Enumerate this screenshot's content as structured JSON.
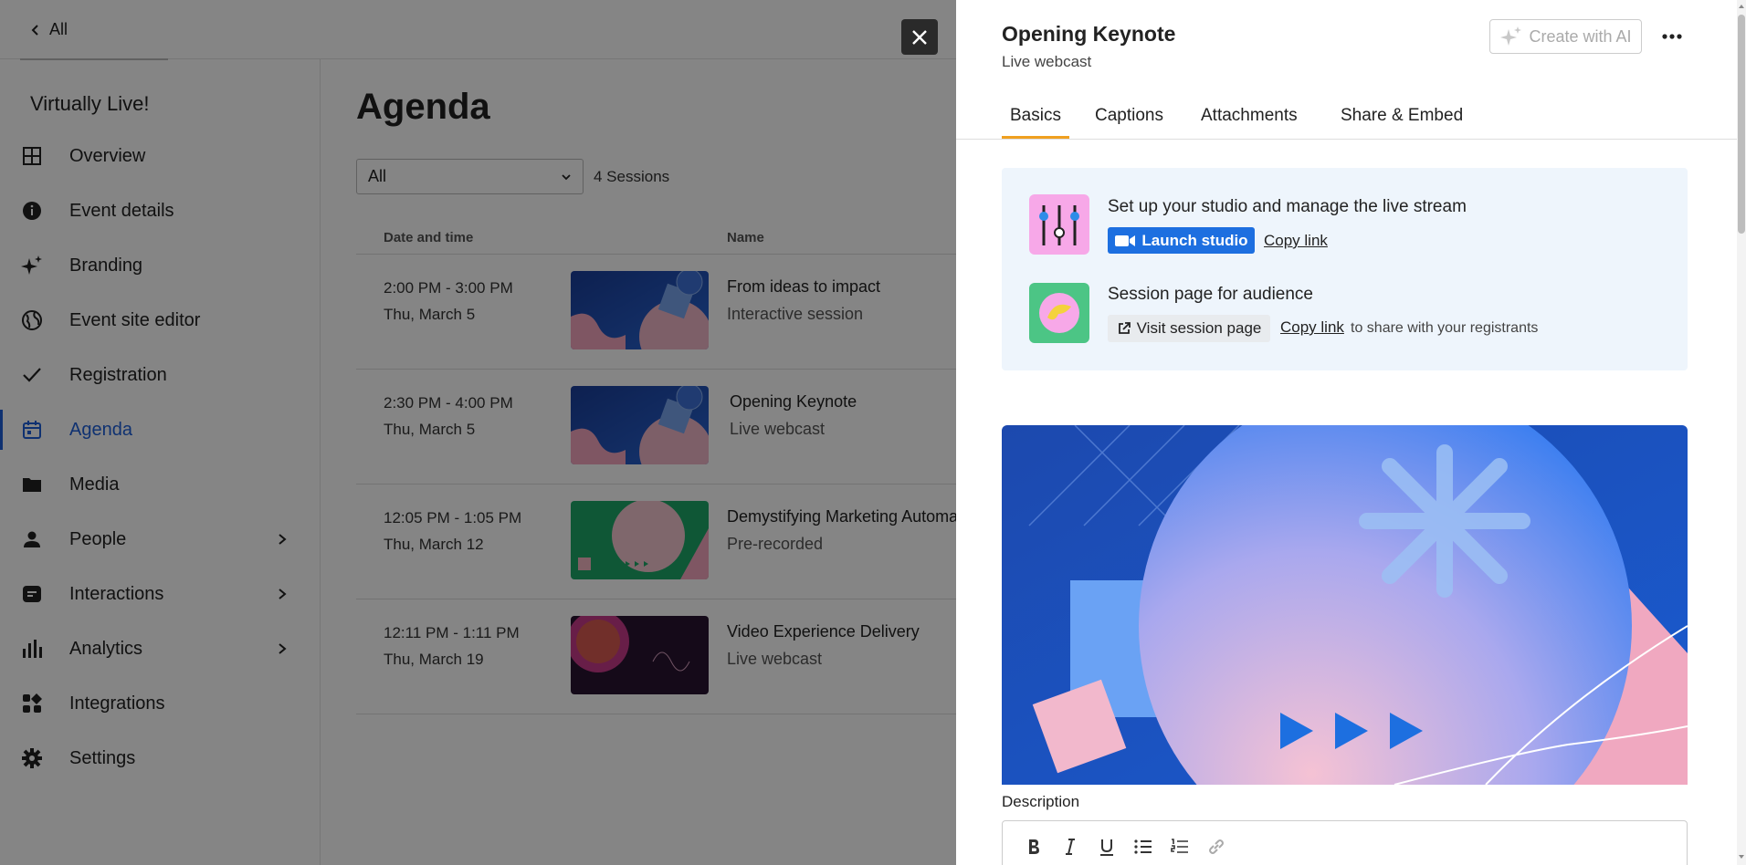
{
  "topbar": {
    "back_label": "All"
  },
  "sidebar": {
    "event_title": "Virtually Live!",
    "items": [
      {
        "label": "Overview",
        "icon": "grid-icon"
      },
      {
        "label": "Event details",
        "icon": "info-icon"
      },
      {
        "label": "Branding",
        "icon": "sparkle-icon"
      },
      {
        "label": "Event site editor",
        "icon": "globe-icon"
      },
      {
        "label": "Registration",
        "icon": "check-icon"
      },
      {
        "label": "Agenda",
        "icon": "calendar-icon",
        "active": true
      },
      {
        "label": "Media",
        "icon": "folder-icon"
      },
      {
        "label": "People",
        "icon": "person-icon",
        "has_submenu": true
      },
      {
        "label": "Interactions",
        "icon": "chat-icon",
        "has_submenu": true
      },
      {
        "label": "Analytics",
        "icon": "bar-chart-icon",
        "has_submenu": true
      },
      {
        "label": "Integrations",
        "icon": "integrations-icon"
      },
      {
        "label": "Settings",
        "icon": "gear-icon"
      }
    ]
  },
  "agenda": {
    "title": "Agenda",
    "filter_value": "All",
    "session_count": "4 Sessions",
    "columns": [
      "Date and time",
      "Name"
    ],
    "rows": [
      {
        "time": "2:00 PM - 3:00 PM",
        "date": "Thu, March 5",
        "name": "From ideas to impact",
        "type": "Interactive session"
      },
      {
        "time": "2:30 PM - 4:00 PM",
        "date": "Thu, March 5",
        "name": "Opening Keynote",
        "type": "Live webcast"
      },
      {
        "time": "12:05 PM - 1:05 PM",
        "date": "Thu, March 12",
        "name": "Demystifying Marketing Automa",
        "type": "Pre-recorded"
      },
      {
        "time": "12:11 PM - 1:11 PM",
        "date": "Thu, March 19",
        "name": "Video Experience Delivery",
        "type": "Live webcast"
      }
    ]
  },
  "panel": {
    "title": "Opening Keynote",
    "subtitle": "Live webcast",
    "ai_button": "Create with AI",
    "tabs": [
      "Basics",
      "Captions",
      "Attachments",
      "Share & Embed"
    ],
    "studio": {
      "heading": "Set up your studio and manage the live stream",
      "launch_label": "Launch studio",
      "copy_label": "Copy link"
    },
    "audience": {
      "heading": "Session page for audience",
      "visit_label": "Visit session page",
      "copy_label": "Copy link",
      "share_text": "to share with your registrants"
    },
    "description_label": "Description",
    "editor_tools": [
      "bold-icon",
      "italic-icon",
      "underline-icon",
      "bullet-list-icon",
      "numbered-list-icon",
      "link-icon"
    ]
  },
  "colors": {
    "accent": "#1d6fe0",
    "tab_underline": "#f0a020",
    "nav_active": "#1d5fd8"
  }
}
